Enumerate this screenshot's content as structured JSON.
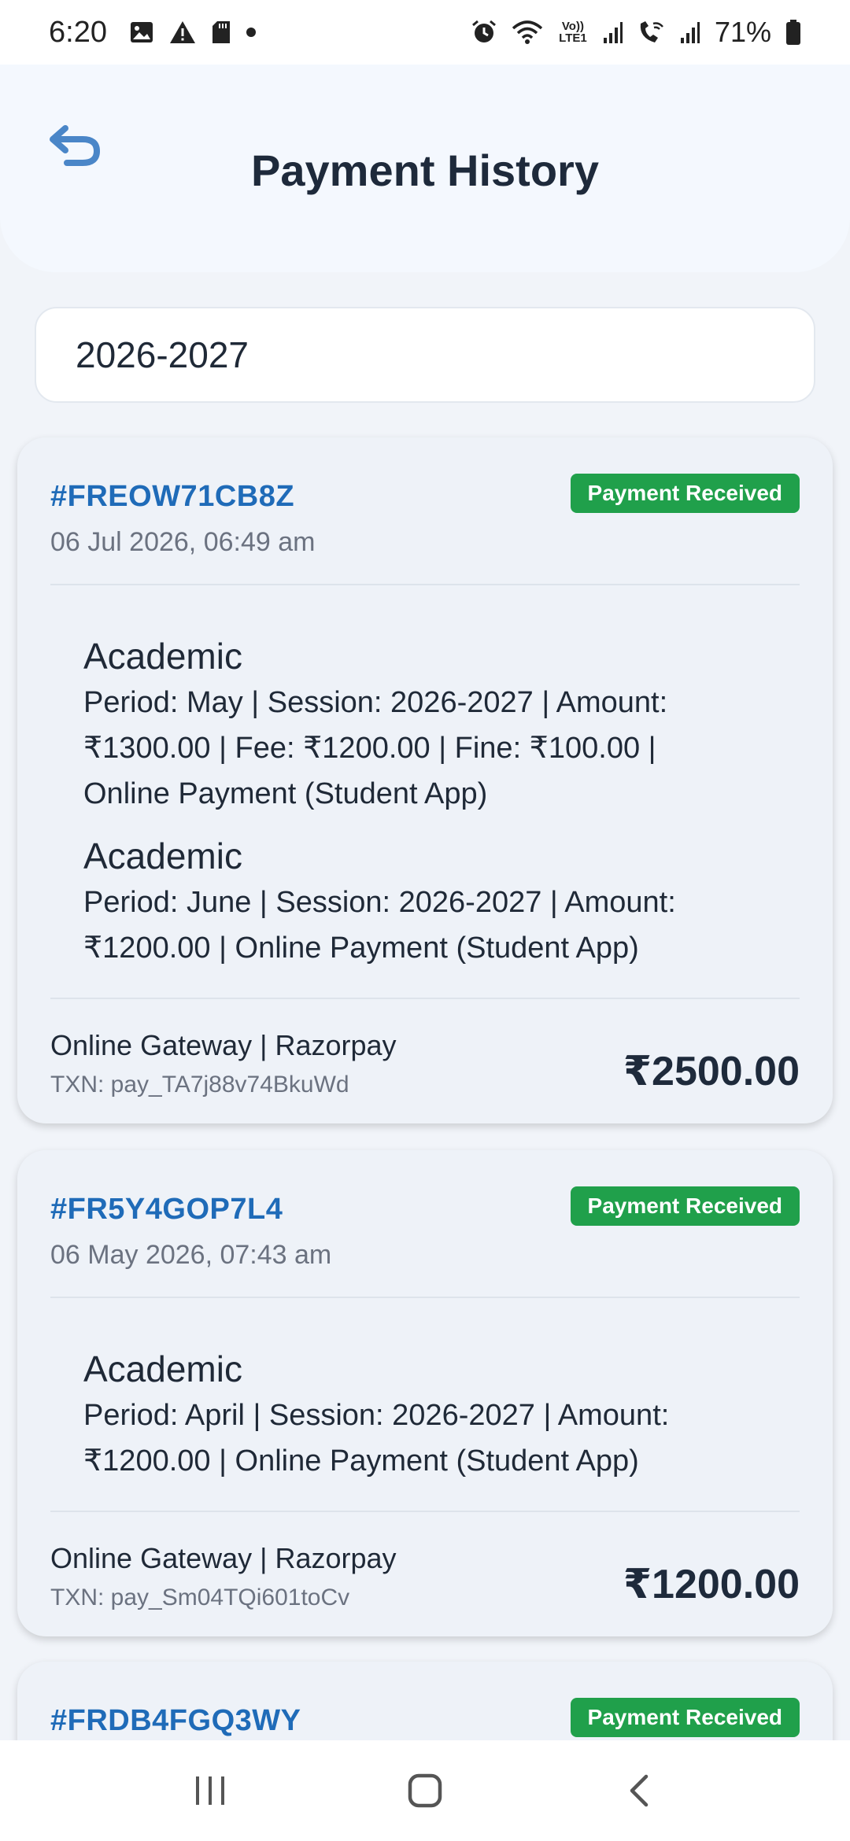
{
  "status_bar": {
    "time": "6:20",
    "battery": "71%",
    "left_icons": [
      "image-icon",
      "warning-icon",
      "sd-card-icon",
      "dot-icon"
    ],
    "right_icons": [
      "alarm-icon",
      "wifi-icon",
      "volte-icon",
      "signal-icon",
      "wifi-call-icon",
      "signal-icon",
      "battery-icon"
    ],
    "volte_label": "Vo)) LTE1"
  },
  "header": {
    "title": "Payment History",
    "back_icon": "back-arrow-icon"
  },
  "session": {
    "value": "2026-2027"
  },
  "colors": {
    "accent": "#1f6bb8",
    "badge": "#20a04b",
    "card_bg": "#eef2f8"
  },
  "payments": [
    {
      "receipt_no": "#FREOW71CB8Z",
      "status": "Payment Received",
      "date": "06 Jul 2026, 06:49 am",
      "items": [
        {
          "title": "Academic",
          "lines": [
            "Period: May | Session: 2026-2027 | Amount:",
            "₹1300.00 | Fee: ₹1200.00 | Fine: ₹100.00 |",
            "Online Payment (Student App)"
          ]
        },
        {
          "title": "Academic",
          "lines": [
            "Period: June | Session: 2026-2027 | Amount:",
            "₹1200.00 | Online Payment (Student App)"
          ]
        }
      ],
      "gateway": "Online Gateway | Razorpay",
      "txn": "TXN: pay_TA7j88v74BkuWd",
      "amount": "₹2500.00"
    },
    {
      "receipt_no": "#FR5Y4GOP7L4",
      "status": "Payment Received",
      "date": "06 May 2026, 07:43 am",
      "items": [
        {
          "title": "Academic",
          "lines": [
            "Period: April | Session: 2026-2027 | Amount:",
            "₹1200.00 | Online Payment (Student App)"
          ]
        }
      ],
      "gateway": "Online Gateway | Razorpay",
      "txn": "TXN: pay_Sm04TQi601toCv",
      "amount": "₹1200.00"
    },
    {
      "receipt_no": "#FRDB4FGQ3WY",
      "status": "Payment Received"
    }
  ],
  "nav": {
    "recents_icon": "recent-apps-icon",
    "home_icon": "home-icon",
    "back_icon": "nav-back-icon"
  }
}
